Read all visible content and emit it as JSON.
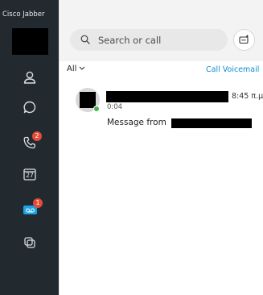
{
  "app": {
    "title": "Cisco Jabber"
  },
  "sidebar": {
    "items": [
      {
        "id": "contacts",
        "icon": "person-icon"
      },
      {
        "id": "chats",
        "icon": "chat-bubble-icon"
      },
      {
        "id": "calls",
        "icon": "phone-icon",
        "badge": "2"
      },
      {
        "id": "meetings",
        "icon": "calendar-icon",
        "day": "27"
      },
      {
        "id": "voicemail",
        "icon": "voicemail-icon",
        "badge": "1"
      },
      {
        "id": "custom-tabs",
        "icon": "overlap-squares-icon"
      }
    ]
  },
  "search": {
    "placeholder": "Search or call",
    "icon": "search-icon"
  },
  "new_message": {
    "icon": "compose-icon"
  },
  "filter": {
    "label": "All"
  },
  "voicemail_link": "Call Voicemail",
  "messages": [
    {
      "time": "8:45 π.μ.",
      "duration": "0:04",
      "text": "Message from"
    }
  ],
  "colors": {
    "sidebar_bg": "#222a30",
    "accent_blue": "#0d8fd6",
    "badge_red": "#e24c38",
    "presence_green": "#47b34a"
  }
}
